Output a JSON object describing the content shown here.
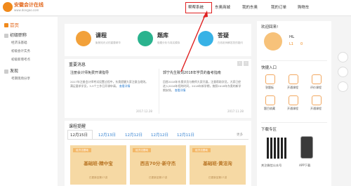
{
  "header": {
    "logo_name": "安徽会计在线",
    "logo_domain": "www.dongao.com",
    "nav": [
      "帮帮系统",
      "东奥商城",
      "我的东奥",
      "我的订单",
      "购物车"
    ]
  },
  "sidebar": {
    "home": "首页",
    "groups": [
      {
        "label": "初级职称",
        "items": [
          "经济法基础",
          "初级会计实务",
          "初级新增考点"
        ]
      },
      {
        "label": "发现",
        "items": [
          "考期现场分享"
        ]
      }
    ]
  },
  "services": [
    {
      "title": "课程",
      "desc": "聚焦知识点的重要精华",
      "color": "#f2a13a",
      "icon": "book-icon"
    },
    {
      "title": "题库",
      "desc": "做题分析与真实模拟",
      "color": "#2ab38e",
      "icon": "pencil-icon"
    },
    {
      "title": "答疑",
      "desc": "在线老师解答您的疑问",
      "color": "#37b2e6",
      "icon": "chat-icon"
    }
  ],
  "news": {
    "title": "重要消息",
    "items": [
      {
        "title": "注册会计师免费开课指导",
        "body": "2017年注册会计师考试设置过程中，东奥提醒大家注意当规则。满足要求学员，3-5个工作日开课申请。",
        "link": "查看详情",
        "date": "2017.12.28"
      },
      {
        "title": "郭宁先生致词2018年学员的备考指南",
        "body": "回首2018年东奥学员与教师大家开展，注意帮助学员，大家已经进入2016年招的时间，2018年新学期，按照2018年东奥的新学期安排。",
        "link": "查看详情",
        "date": "2017.11.28"
      }
    ]
  },
  "courses": {
    "title": "课程提醒",
    "more": "更多",
    "dates": [
      "12月15日",
      "12月13日",
      "12月12日",
      "12月12日",
      "12月11日"
    ],
    "cards": [
      {
        "tag": "经济法基础",
        "title": "基础班·精中宝",
        "foot": "已更新至第17讲"
      },
      {
        "tag": "经济法基础",
        "title": "西吉70分·新守杰",
        "foot": "已更新至第17讲"
      },
      {
        "tag": "经济法基础",
        "title": "基础班·黄洁洵",
        "foot": "已更新至第17讲"
      }
    ]
  },
  "profile": {
    "welcome": "欢迎回来!",
    "name": "HL",
    "level": "L1",
    "coins": "0"
  },
  "quick": {
    "title": "快捷入口",
    "items": [
      "答题板",
      "开通课程",
      "评价课程",
      "题目收藏",
      "开通课程",
      "开通课程"
    ]
  },
  "download": {
    "title": "下载专区",
    "wechat": "关注微信公众号",
    "app": "APP下载"
  },
  "colors": {
    "accent": "#f08a1c",
    "highlight": "#e02020",
    "tab_active": "#2f7fd0"
  }
}
